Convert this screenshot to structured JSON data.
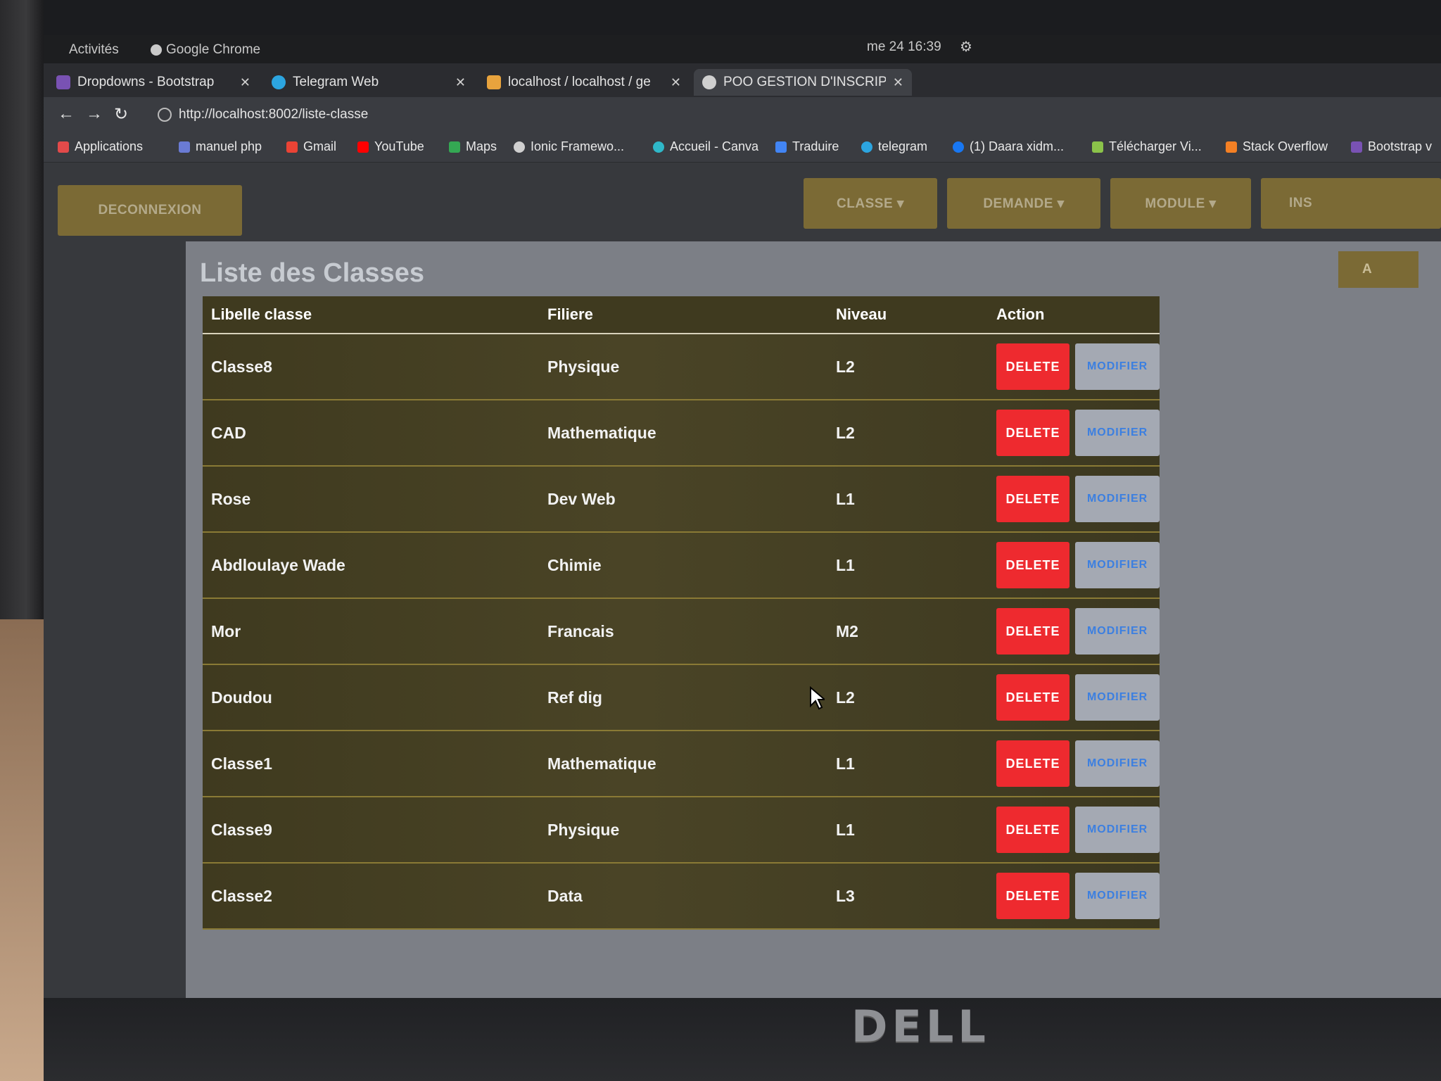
{
  "topbar": {
    "activities": "Activités",
    "app": "Google Chrome",
    "clock": "me 24 16:39"
  },
  "tabs": [
    {
      "title": "Dropdowns - Bootstrap",
      "icon": "bootstrap-icon",
      "color": "#7952b3"
    },
    {
      "title": "Telegram Web",
      "icon": "telegram-icon",
      "color": "#2ca5e0"
    },
    {
      "title": "localhost / localhost / ge",
      "icon": "phpmyadmin-icon",
      "color": "#e8a33d"
    },
    {
      "title": "POO GESTION D'INSCRIP",
      "icon": "globe-icon",
      "color": "#cfcfcf"
    }
  ],
  "address": {
    "url": "http://localhost:8002/liste-classe"
  },
  "bookmarks": [
    {
      "label": "Applications",
      "color": "#e24a4a"
    },
    {
      "label": "manuel php",
      "color": "#6a7bd4"
    },
    {
      "label": "Gmail",
      "color": "#ea4335"
    },
    {
      "label": "YouTube",
      "color": "#ff0000"
    },
    {
      "label": "Maps",
      "color": "#34a853"
    },
    {
      "label": "Ionic Framewo...",
      "color": "#cfcfcf"
    },
    {
      "label": "Accueil - Canva",
      "color": "#2fb8c9"
    },
    {
      "label": "Traduire",
      "color": "#4285f4"
    },
    {
      "label": "telegram",
      "color": "#2ca5e0"
    },
    {
      "label": "(1) Daara xidm...",
      "color": "#1877f2"
    },
    {
      "label": "Télécharger Vi...",
      "color": "#8bc34a"
    },
    {
      "label": "Stack Overflow",
      "color": "#f48024"
    },
    {
      "label": "Bootstrap v",
      "color": "#7952b3"
    }
  ],
  "nav": {
    "logout": "DECONNEXION",
    "menus": [
      "CLASSE ▾",
      "DEMANDE ▾",
      "MODULE ▾",
      "INS"
    ]
  },
  "panel": {
    "title": "Liste des Classes",
    "add_label": "A"
  },
  "table": {
    "headers": [
      "Libelle classe",
      "Filiere",
      "Niveau",
      "Action"
    ],
    "rows": [
      {
        "libelle": "Classe8",
        "filiere": "Physique",
        "niveau": "L2"
      },
      {
        "libelle": "CAD",
        "filiere": "Mathematique",
        "niveau": "L2"
      },
      {
        "libelle": "Rose",
        "filiere": "Dev Web",
        "niveau": "L1"
      },
      {
        "libelle": "Abdloulaye Wade",
        "filiere": "Chimie",
        "niveau": "L1"
      },
      {
        "libelle": "Mor",
        "filiere": "Francais",
        "niveau": "M2"
      },
      {
        "libelle": "Doudou",
        "filiere": "Ref dig",
        "niveau": "L2"
      },
      {
        "libelle": "Classe1",
        "filiere": "Mathematique",
        "niveau": "L1"
      },
      {
        "libelle": "Classe9",
        "filiere": "Physique",
        "niveau": "L1"
      },
      {
        "libelle": "Classe2",
        "filiere": "Data",
        "niveau": "L3"
      }
    ],
    "delete_label": "DELETE",
    "modify_label": "MODIFIER"
  },
  "device": {
    "brand": "DELL"
  }
}
